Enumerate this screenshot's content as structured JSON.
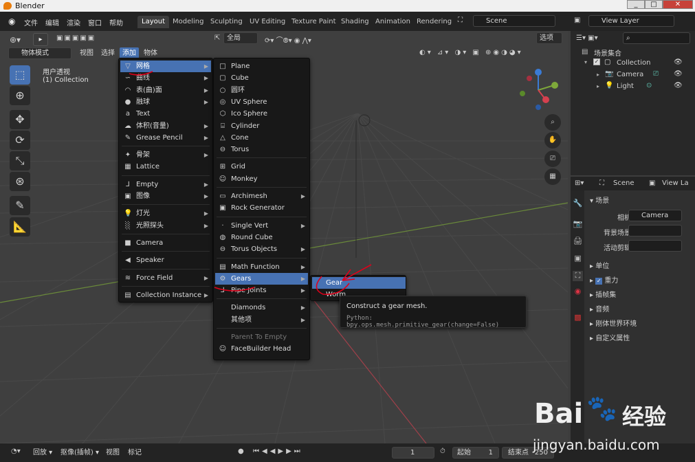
{
  "window": {
    "title": "Blender",
    "min": "_",
    "max": "□",
    "close": "✕"
  },
  "topbar": {
    "menus": [
      "文件",
      "编辑",
      "渲染",
      "窗口",
      "帮助"
    ],
    "workspaces": [
      "Layout",
      "Modeling",
      "Sculpting",
      "UV Editing",
      "Texture Paint",
      "Shading",
      "Animation",
      "Rendering"
    ],
    "scene_field": "Scene",
    "view_layer_field": "View Layer"
  },
  "viewport_header": {
    "mode": "物体模式",
    "menus": [
      "视图",
      "选择",
      "添加",
      "物体"
    ],
    "pivot": "全局",
    "options": "选项"
  },
  "viewport": {
    "view_name": "用户透视",
    "collection_label": "(1) Collection"
  },
  "add_menu": {
    "items": [
      {
        "label": "网格",
        "icon": "▽",
        "sub": true
      },
      {
        "label": "曲线",
        "icon": "∽",
        "sub": true
      },
      {
        "label": "表(曲)面",
        "icon": "◠",
        "sub": true
      },
      {
        "label": "融球",
        "icon": "●",
        "sub": true
      },
      {
        "label": "Text",
        "icon": "a",
        "sub": false
      },
      {
        "label": "体积(音量)",
        "icon": "☁",
        "sub": true
      },
      {
        "label": "Grease Pencil",
        "icon": "✎",
        "sub": true
      },
      {
        "label": "骨架",
        "icon": "✦",
        "sub": true
      },
      {
        "label": "Lattice",
        "icon": "▦",
        "sub": false
      },
      {
        "label": "Empty",
        "icon": "⅃",
        "sub": true
      },
      {
        "label": "图像",
        "icon": "▣",
        "sub": true
      },
      {
        "label": "灯光",
        "icon": "💡",
        "sub": true
      },
      {
        "label": "光照探头",
        "icon": "░",
        "sub": true
      },
      {
        "label": "Camera",
        "icon": "■",
        "sub": false
      },
      {
        "label": "Speaker",
        "icon": "◀",
        "sub": false
      },
      {
        "label": "Force Field",
        "icon": "≋",
        "sub": true
      },
      {
        "label": "Collection Instance",
        "icon": "▤",
        "sub": true
      }
    ]
  },
  "mesh_menu": {
    "items": [
      {
        "label": "Plane",
        "icon": "□",
        "sub": false
      },
      {
        "label": "Cube",
        "icon": "▢",
        "sub": false
      },
      {
        "label": "圆环",
        "icon": "○",
        "sub": false
      },
      {
        "label": "UV Sphere",
        "icon": "◎",
        "sub": false
      },
      {
        "label": "Ico Sphere",
        "icon": "⬡",
        "sub": false
      },
      {
        "label": "Cylinder",
        "icon": "⌸",
        "sub": false
      },
      {
        "label": "Cone",
        "icon": "△",
        "sub": false
      },
      {
        "label": "Torus",
        "icon": "⊖",
        "sub": false
      },
      {
        "label": "Grid",
        "icon": "⊞",
        "sub": false
      },
      {
        "label": "Monkey",
        "icon": "☺",
        "sub": false
      },
      {
        "label": "Archimesh",
        "icon": "▭",
        "sub": true
      },
      {
        "label": "Rock Generator",
        "icon": "▣",
        "sub": false
      },
      {
        "label": "Single Vert",
        "icon": "·",
        "sub": true
      },
      {
        "label": "Round Cube",
        "icon": "◍",
        "sub": false
      },
      {
        "label": "Torus Objects",
        "icon": "⊖",
        "sub": true
      },
      {
        "label": "Math Function",
        "icon": "▤",
        "sub": true
      },
      {
        "label": "Gears",
        "icon": "⚙",
        "sub": true
      },
      {
        "label": "Pipe Joints",
        "icon": "⅃",
        "sub": true
      },
      {
        "label": "Diamonds",
        "icon": "",
        "sub": true
      },
      {
        "label": "其他项",
        "icon": "",
        "sub": true
      },
      {
        "label": "Parent To Empty",
        "icon": "",
        "sub": false,
        "dim": true
      },
      {
        "label": "FaceBuilder Head",
        "icon": "☺",
        "sub": false
      }
    ]
  },
  "gears_menu": {
    "items": [
      "Gear",
      "Worm"
    ]
  },
  "tooltip": {
    "title": "Construct a gear mesh.",
    "python": "Python: bpy.ops.mesh.primitive_gear(change=False)"
  },
  "outliner": {
    "root": "场景集合",
    "collection": "Collection",
    "objects": [
      "Camera",
      "Light"
    ]
  },
  "properties": {
    "scene_tab": "Scene",
    "view_layer_tab": "View La",
    "section_scene": "场景",
    "camera_label": "相机",
    "camera_value": "Camera",
    "bg_label": "背景场景",
    "clip_label": "活动剪辑",
    "sections": [
      "单位",
      "重力",
      "插帧集",
      "音频",
      "刚体世界环境",
      "自定义属性"
    ]
  },
  "timeline": {
    "menus": [
      "回放",
      "抠像(插帧)",
      "视图",
      "标记"
    ],
    "current_frame": "1",
    "start_label": "起始",
    "start_value": "1",
    "end_label": "结束点",
    "end_value": "250"
  },
  "watermark": {
    "brand": "Bai",
    "brand_cn": "经验",
    "url": "jingyan.baidu.com"
  },
  "colors": {
    "accent": "#4772b3",
    "bg": "#3d3d3d",
    "annotation": "#e0001a"
  }
}
